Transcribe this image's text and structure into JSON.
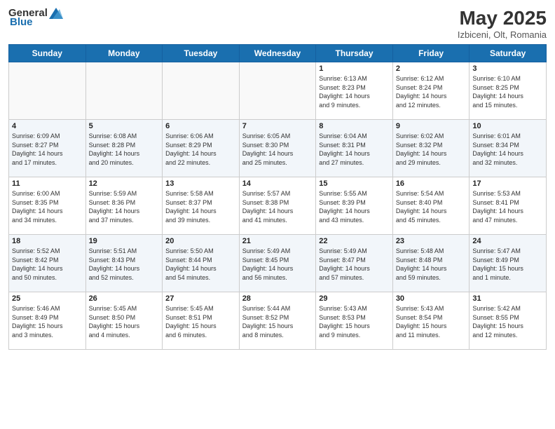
{
  "header": {
    "logo_general": "General",
    "logo_blue": "Blue",
    "month": "May 2025",
    "location": "Izbiceni, Olt, Romania"
  },
  "days_of_week": [
    "Sunday",
    "Monday",
    "Tuesday",
    "Wednesday",
    "Thursday",
    "Friday",
    "Saturday"
  ],
  "weeks": [
    [
      {
        "num": "",
        "detail": ""
      },
      {
        "num": "",
        "detail": ""
      },
      {
        "num": "",
        "detail": ""
      },
      {
        "num": "",
        "detail": ""
      },
      {
        "num": "1",
        "detail": "Sunrise: 6:13 AM\nSunset: 8:23 PM\nDaylight: 14 hours\nand 9 minutes."
      },
      {
        "num": "2",
        "detail": "Sunrise: 6:12 AM\nSunset: 8:24 PM\nDaylight: 14 hours\nand 12 minutes."
      },
      {
        "num": "3",
        "detail": "Sunrise: 6:10 AM\nSunset: 8:25 PM\nDaylight: 14 hours\nand 15 minutes."
      }
    ],
    [
      {
        "num": "4",
        "detail": "Sunrise: 6:09 AM\nSunset: 8:27 PM\nDaylight: 14 hours\nand 17 minutes."
      },
      {
        "num": "5",
        "detail": "Sunrise: 6:08 AM\nSunset: 8:28 PM\nDaylight: 14 hours\nand 20 minutes."
      },
      {
        "num": "6",
        "detail": "Sunrise: 6:06 AM\nSunset: 8:29 PM\nDaylight: 14 hours\nand 22 minutes."
      },
      {
        "num": "7",
        "detail": "Sunrise: 6:05 AM\nSunset: 8:30 PM\nDaylight: 14 hours\nand 25 minutes."
      },
      {
        "num": "8",
        "detail": "Sunrise: 6:04 AM\nSunset: 8:31 PM\nDaylight: 14 hours\nand 27 minutes."
      },
      {
        "num": "9",
        "detail": "Sunrise: 6:02 AM\nSunset: 8:32 PM\nDaylight: 14 hours\nand 29 minutes."
      },
      {
        "num": "10",
        "detail": "Sunrise: 6:01 AM\nSunset: 8:34 PM\nDaylight: 14 hours\nand 32 minutes."
      }
    ],
    [
      {
        "num": "11",
        "detail": "Sunrise: 6:00 AM\nSunset: 8:35 PM\nDaylight: 14 hours\nand 34 minutes."
      },
      {
        "num": "12",
        "detail": "Sunrise: 5:59 AM\nSunset: 8:36 PM\nDaylight: 14 hours\nand 37 minutes."
      },
      {
        "num": "13",
        "detail": "Sunrise: 5:58 AM\nSunset: 8:37 PM\nDaylight: 14 hours\nand 39 minutes."
      },
      {
        "num": "14",
        "detail": "Sunrise: 5:57 AM\nSunset: 8:38 PM\nDaylight: 14 hours\nand 41 minutes."
      },
      {
        "num": "15",
        "detail": "Sunrise: 5:55 AM\nSunset: 8:39 PM\nDaylight: 14 hours\nand 43 minutes."
      },
      {
        "num": "16",
        "detail": "Sunrise: 5:54 AM\nSunset: 8:40 PM\nDaylight: 14 hours\nand 45 minutes."
      },
      {
        "num": "17",
        "detail": "Sunrise: 5:53 AM\nSunset: 8:41 PM\nDaylight: 14 hours\nand 47 minutes."
      }
    ],
    [
      {
        "num": "18",
        "detail": "Sunrise: 5:52 AM\nSunset: 8:42 PM\nDaylight: 14 hours\nand 50 minutes."
      },
      {
        "num": "19",
        "detail": "Sunrise: 5:51 AM\nSunset: 8:43 PM\nDaylight: 14 hours\nand 52 minutes."
      },
      {
        "num": "20",
        "detail": "Sunrise: 5:50 AM\nSunset: 8:44 PM\nDaylight: 14 hours\nand 54 minutes."
      },
      {
        "num": "21",
        "detail": "Sunrise: 5:49 AM\nSunset: 8:45 PM\nDaylight: 14 hours\nand 56 minutes."
      },
      {
        "num": "22",
        "detail": "Sunrise: 5:49 AM\nSunset: 8:47 PM\nDaylight: 14 hours\nand 57 minutes."
      },
      {
        "num": "23",
        "detail": "Sunrise: 5:48 AM\nSunset: 8:48 PM\nDaylight: 14 hours\nand 59 minutes."
      },
      {
        "num": "24",
        "detail": "Sunrise: 5:47 AM\nSunset: 8:49 PM\nDaylight: 15 hours\nand 1 minute."
      }
    ],
    [
      {
        "num": "25",
        "detail": "Sunrise: 5:46 AM\nSunset: 8:49 PM\nDaylight: 15 hours\nand 3 minutes."
      },
      {
        "num": "26",
        "detail": "Sunrise: 5:45 AM\nSunset: 8:50 PM\nDaylight: 15 hours\nand 4 minutes."
      },
      {
        "num": "27",
        "detail": "Sunrise: 5:45 AM\nSunset: 8:51 PM\nDaylight: 15 hours\nand 6 minutes."
      },
      {
        "num": "28",
        "detail": "Sunrise: 5:44 AM\nSunset: 8:52 PM\nDaylight: 15 hours\nand 8 minutes."
      },
      {
        "num": "29",
        "detail": "Sunrise: 5:43 AM\nSunset: 8:53 PM\nDaylight: 15 hours\nand 9 minutes."
      },
      {
        "num": "30",
        "detail": "Sunrise: 5:43 AM\nSunset: 8:54 PM\nDaylight: 15 hours\nand 11 minutes."
      },
      {
        "num": "31",
        "detail": "Sunrise: 5:42 AM\nSunset: 8:55 PM\nDaylight: 15 hours\nand 12 minutes."
      }
    ]
  ]
}
